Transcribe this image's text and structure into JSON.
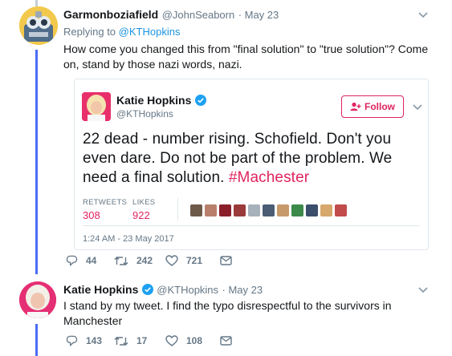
{
  "tweet1": {
    "display_name": "Garmonboziafield",
    "handle": "@JohnSeaborn",
    "date": "· May 23",
    "replying_prefix": "Replying to",
    "replying_handle": "@KTHopkins",
    "text": "How come you changed this from \"final solution\" to \"true solution\"? Come on, stand by those nazi words, nazi.",
    "actions": {
      "replies": "44",
      "retweets": "242",
      "likes": "721"
    }
  },
  "quoted": {
    "display_name": "Katie Hopkins",
    "handle": "@KTHopkins",
    "follow_label": "Follow",
    "text_main": "22 dead - number rising. Schofield. Don't you even dare. Do not be part of the problem. We need a final solution.",
    "hashtag": "#Machester",
    "retweets_label": "RETWEETS",
    "likes_label": "LIKES",
    "retweets": "308",
    "likes": "922",
    "timestamp": "1:24 AM - 23 May 2017"
  },
  "tweet2": {
    "display_name": "Katie Hopkins",
    "handle": "@KTHopkins",
    "date": "· May 23",
    "text": "I stand by my tweet. I find the typo disrespectful to the survivors in Manchester",
    "actions": {
      "replies": "143",
      "retweets": "17",
      "likes": "108"
    }
  },
  "colors": {
    "link": "#1b95e0",
    "follow_red": "#e0245e",
    "verified": "#1da1f2",
    "thread_line": "#c4cfd6",
    "reply_thread": "#4a6cf7"
  },
  "icons": [
    "chevron-down-icon",
    "verified-badge-icon",
    "follow-person-icon",
    "reply-icon",
    "retweet-icon",
    "like-icon",
    "message-icon"
  ]
}
